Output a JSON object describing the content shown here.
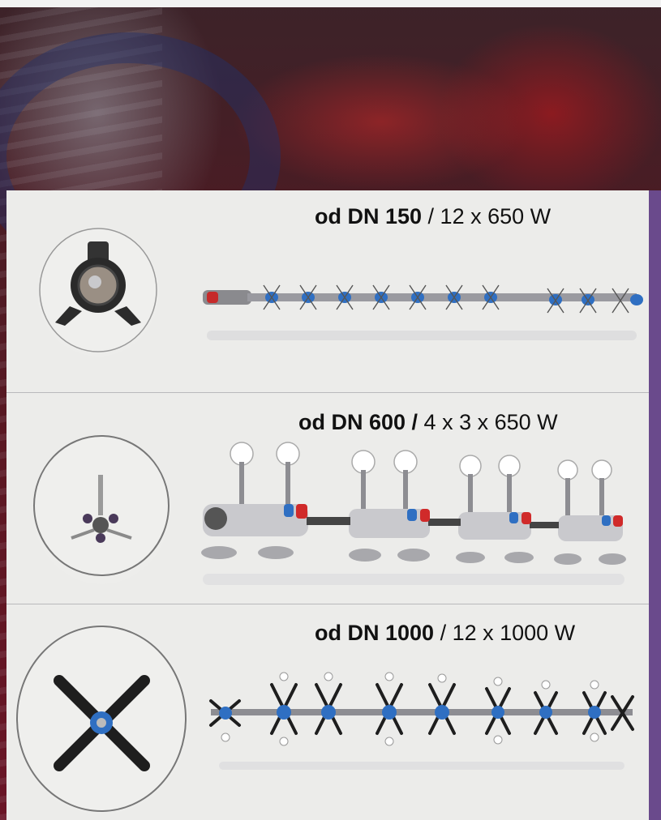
{
  "models": [
    {
      "model": "od DN 150",
      "spec": " / 12 x 650 W"
    },
    {
      "model": "od DN 600 /",
      "spec": " 4 x 3 x 650 W"
    },
    {
      "model": "od DN 1000",
      "spec": " / 12 x 1000 W"
    }
  ],
  "colors": {
    "accent": "#6a4a8c",
    "panel": "#ececea",
    "robot_blue": "#2f6fc2",
    "robot_red": "#d02a2a"
  }
}
